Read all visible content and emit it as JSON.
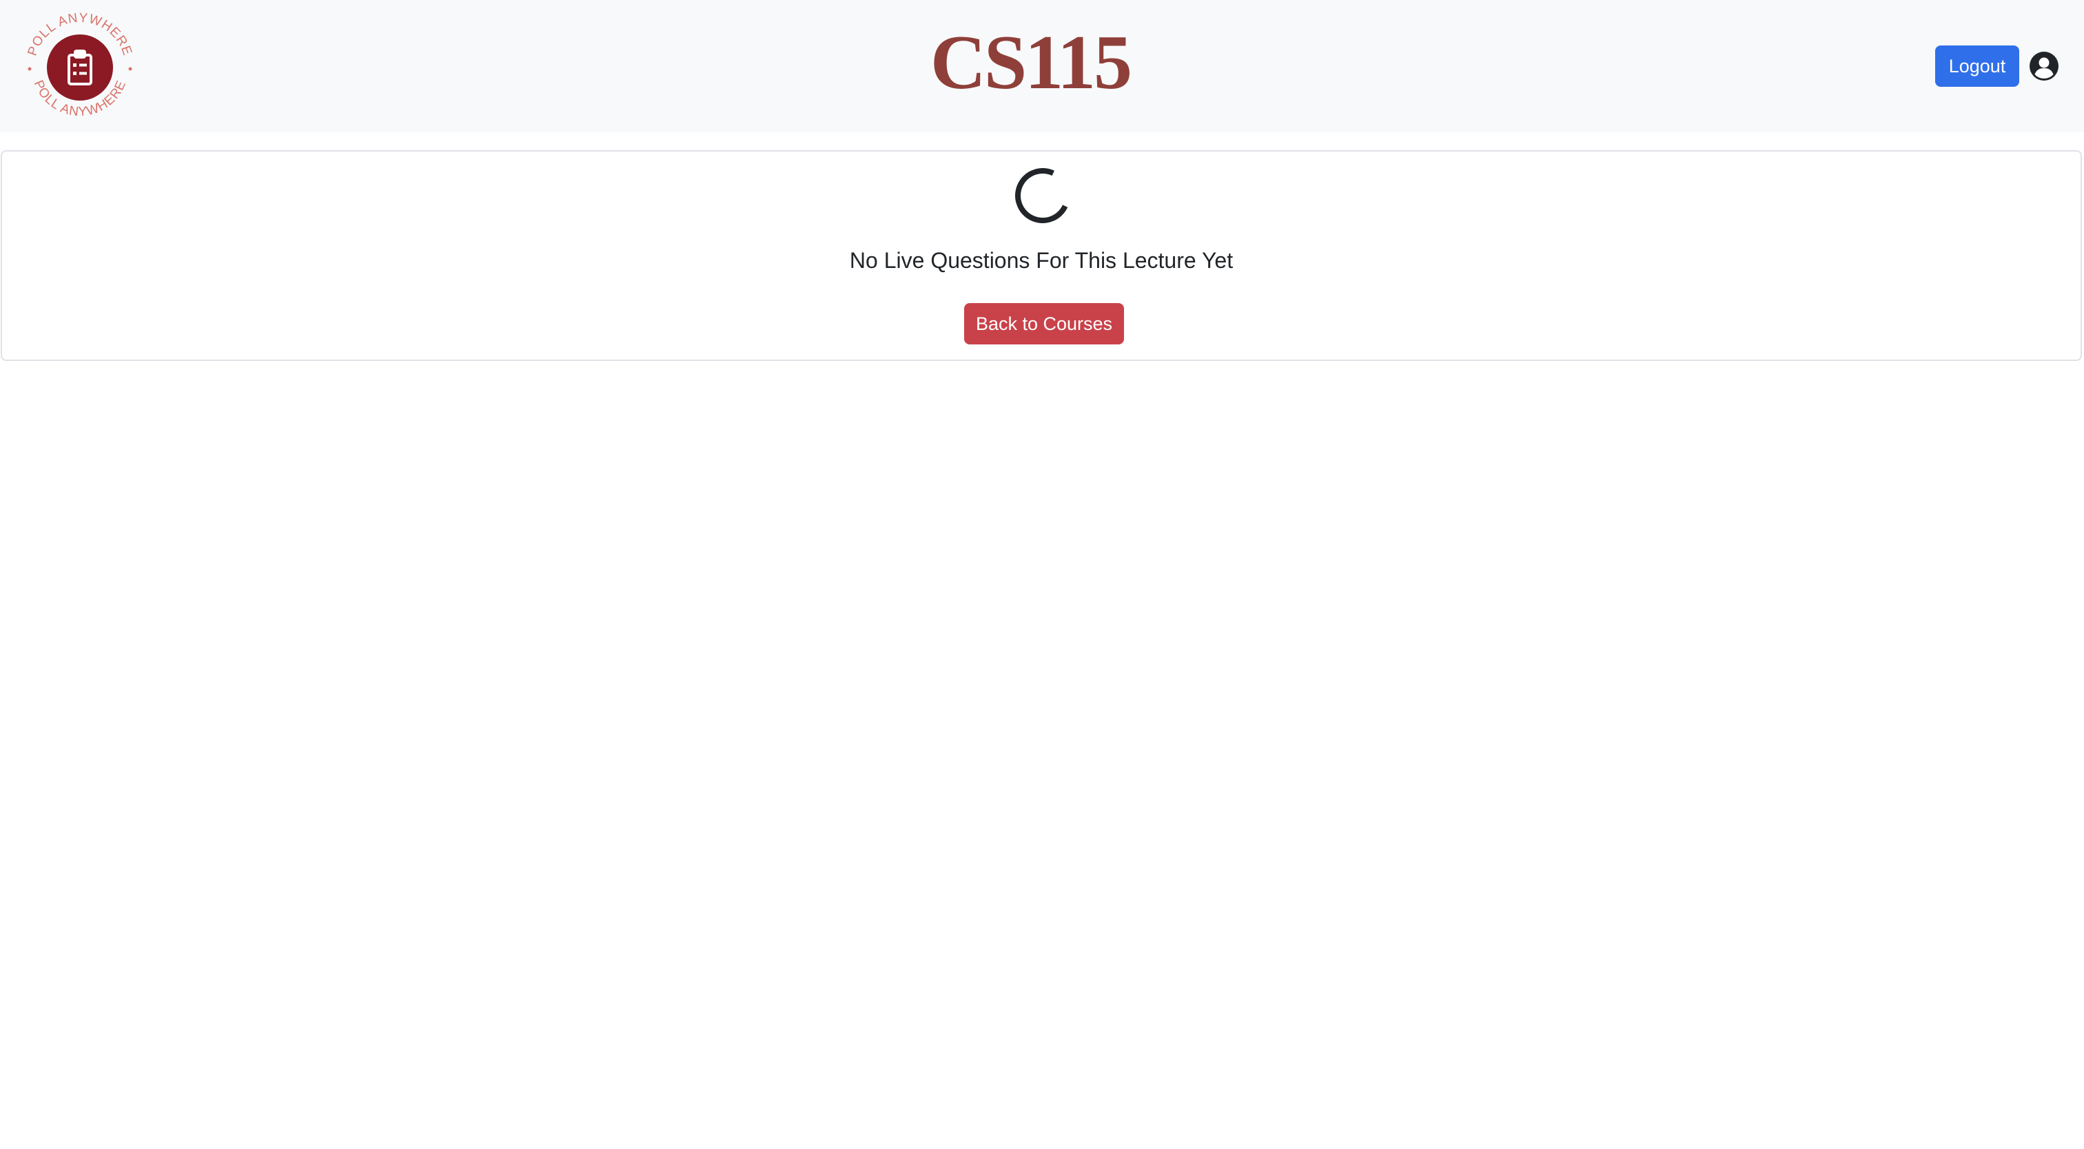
{
  "header": {
    "logo": {
      "ring_text": "POLL ANYWHERE",
      "icon": "clipboard-list-icon",
      "ring_color": "#d9746c",
      "disc_color": "#8b1a24"
    },
    "title": "CS115",
    "title_color": "#8f3f39",
    "logout_label": "Logout",
    "logout_color": "#2f6fea",
    "user_icon": "user-circle-icon"
  },
  "main": {
    "spinner": "loading-spinner",
    "message": "No Live Questions For This Lecture Yet",
    "back_label": "Back to Courses",
    "back_color": "#c9424a"
  }
}
